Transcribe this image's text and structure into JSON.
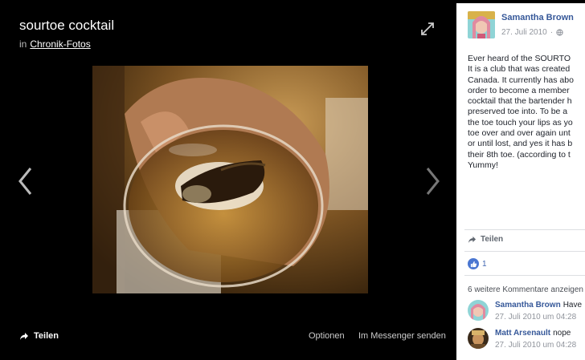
{
  "viewer": {
    "title": "sourtoe cocktail",
    "album_prefix": "in",
    "album_link": "Chronik-Fotos",
    "share_label": "Teilen",
    "options_label": "Optionen",
    "messenger_label": "Im Messenger senden"
  },
  "post": {
    "author": "Samantha Brown",
    "date": "27. Juli 2010",
    "text_lines": [
      "Ever heard of the SOURTO",
      "It is a club that was created",
      "Canada. It currently has abo",
      "order to become a member",
      "cocktail that the bartender h",
      "preserved toe into. To be a",
      "the toe touch your lips as yo",
      "toe over and over again unt",
      "or until lost, and yes it has b",
      "their 8th toe. (according to t",
      " Yummy!"
    ],
    "share_label": "Teilen",
    "like_count": "1",
    "more_comments": "6 weitere Kommentare anzeigen"
  },
  "comments": [
    {
      "author": "Samantha Brown",
      "text": "Have",
      "date": "27. Juli 2010 um 04:28"
    },
    {
      "author": "Matt Arsenault",
      "text": "nope",
      "date": "27. Juli 2010 um 04:28"
    }
  ],
  "colors": {
    "link": "#365899",
    "like": "#4a76d1"
  },
  "icons": [
    "expand-icon",
    "chevron-left-icon",
    "chevron-right-icon",
    "share-arrow-icon",
    "globe-icon",
    "thumbs-up-icon"
  ]
}
